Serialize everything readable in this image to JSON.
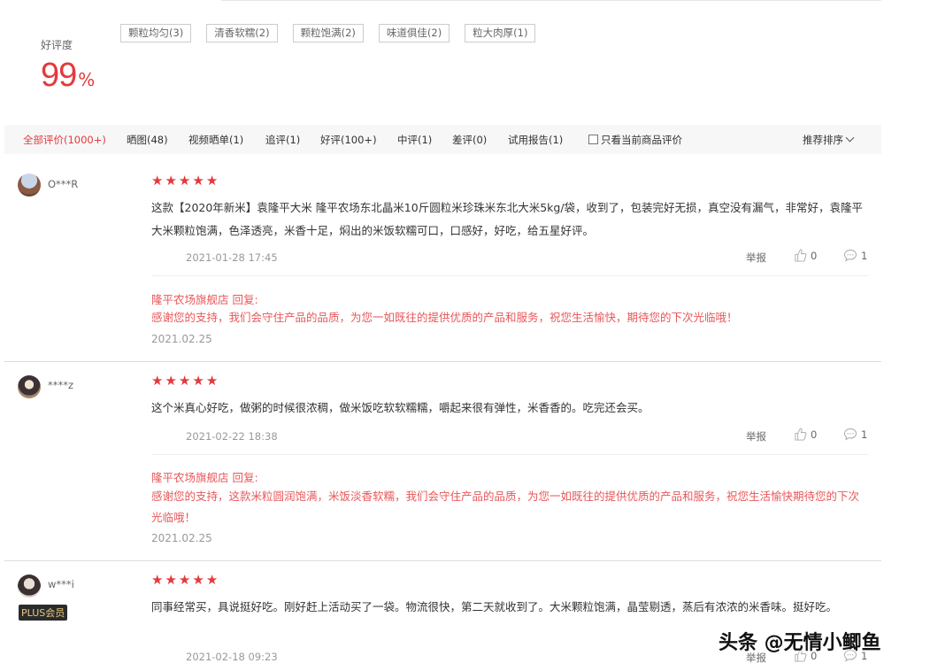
{
  "summary": {
    "label": "好评度",
    "value": "99",
    "unit": "%"
  },
  "tags": [
    "颗粒均匀(3)",
    "清香软糯(2)",
    "颗粒饱满(2)",
    "味道俱佳(2)",
    "粒大肉厚(1)"
  ],
  "filters": {
    "items": [
      "全部评价(1000+)",
      "晒图(48)",
      "视频晒单(1)",
      "追评(1)",
      "好评(100+)",
      "中评(1)",
      "差评(0)",
      "试用报告(1)"
    ],
    "checkbox_label": "只看当前商品评价",
    "sort_label": "推荐排序"
  },
  "colors": {
    "accent": "#e4393c",
    "filter_bg": "#f7f7f7"
  },
  "reviews": [
    {
      "user": "O***R",
      "stars": 5,
      "content": "这款【2020年新米】袁隆平大米 隆平农场东北晶米10斤圆粒米珍珠米东北大米5kg/袋，收到了，包装完好无损，真空没有漏气，非常好，袁隆平大米颗粒饱满，色泽透亮，米香十足，焖出的米饭软糯可口，口感好，好吃，给五星好评。",
      "date": "2021-01-28 17:45",
      "report": "举报",
      "likes": "0",
      "comments": "1",
      "reply_head": "隆平农场旗舰店 回复:",
      "reply_text": "感谢您的支持，我们会守住产品的品质，为您一如既往的提供优质的产品和服务，祝您生活愉快，期待您的下次光临哦！",
      "reply_date": "2021.02.25"
    },
    {
      "user": "****z",
      "stars": 5,
      "content": "这个米真心好吃，做粥的时候很浓稠，做米饭吃软软糯糯，嚼起来很有弹性，米香香的。吃完还会买。",
      "date": "2021-02-22 18:38",
      "report": "举报",
      "likes": "0",
      "comments": "1",
      "reply_head": "隆平农场旗舰店 回复:",
      "reply_text": "感谢您的支持，这款米粒圆润饱满，米饭淡香软糯，我们会守住产品的品质，为您一如既往的提供优质的产品和服务，祝您生活愉快期待您的下次光临哦！",
      "reply_date": "2021.02.25"
    },
    {
      "user": "w***i",
      "badge": "PLUS会员",
      "stars": 5,
      "content": "同事经常买，具说挺好吃。刚好赶上活动买了一袋。物流很快，第二天就收到了。大米颗粒饱满，晶莹剔透，蒸后有浓浓的米香味。挺好吃。",
      "date": "2021-02-18 09:23",
      "report": "举报",
      "likes": "0",
      "comments": "1"
    }
  ],
  "watermark": "头条 @无情小鲫鱼"
}
